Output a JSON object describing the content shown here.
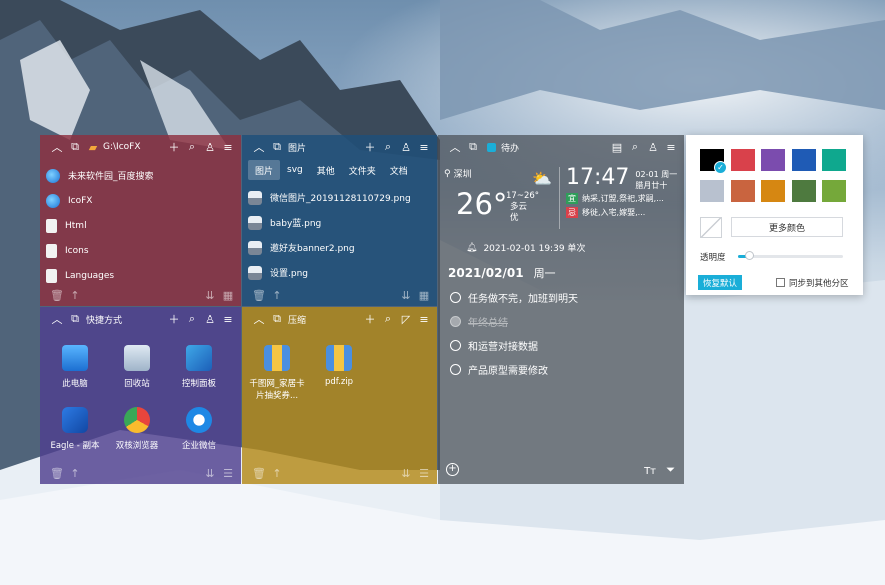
{
  "colors": {
    "folder_panel": "#8e3040",
    "images_panel": "#1e4f7a",
    "shortcuts_panel": "#4f3f8f",
    "compress_panel": "#b58a19",
    "todo_panel": "#4a4f56",
    "accent": "#1aaed8"
  },
  "folder_panel": {
    "title": "G:\\IcoFX",
    "items": [
      {
        "label": "未来软件园_百度搜索",
        "icon": "browser-icon"
      },
      {
        "label": "IcoFX",
        "icon": "browser-icon"
      },
      {
        "label": "Html",
        "icon": "file-icon"
      },
      {
        "label": "Icons",
        "icon": "file-icon"
      },
      {
        "label": "Languages",
        "icon": "file-icon"
      }
    ]
  },
  "images_panel": {
    "title": "图片",
    "tabs": [
      "图片",
      "svg",
      "其他",
      "文件夹",
      "文档"
    ],
    "items": [
      {
        "label": "微信图片_20191128110729.png",
        "icon": "image-file-icon"
      },
      {
        "label": "baby蓝.png",
        "icon": "image-file-icon"
      },
      {
        "label": "邀好友banner2.png",
        "icon": "image-file-icon"
      },
      {
        "label": "设置.png",
        "icon": "image-file-icon"
      }
    ]
  },
  "shortcuts_panel": {
    "title": "快捷方式",
    "items": [
      {
        "label": "此电脑",
        "icon": "computer-icon"
      },
      {
        "label": "回收站",
        "icon": "recycle-bin-icon"
      },
      {
        "label": "控制面板",
        "icon": "control-panel-icon"
      },
      {
        "label": "Eagle - 副本",
        "icon": "eagle-icon"
      },
      {
        "label": "双核浏览器",
        "icon": "chrome-icon"
      },
      {
        "label": "企业微信",
        "icon": "wecom-icon"
      }
    ]
  },
  "compress_panel": {
    "title": "压缩",
    "items": [
      {
        "label": "千图网_家居卡片抽奖券...",
        "icon": "zip-icon"
      },
      {
        "label": "pdf.zip",
        "icon": "zip-icon"
      }
    ]
  },
  "todo_panel": {
    "title": "待办",
    "city": "深圳",
    "temperature": "26°",
    "temp_range": "17~26°",
    "weather": "多云",
    "air": "优",
    "time": "17:47",
    "date_short": "02-01 周一",
    "lunar": "腊月廿十",
    "good_tag": "宜",
    "good_text": "纳采,订盟,祭祀,求嗣,...",
    "bad_tag": "忌",
    "bad_text": "移徙,入宅,嫁娶,...",
    "reminder": "2021-02-01 19:39  单次",
    "date_heading": "2021/02/01",
    "weekday": "周一",
    "tasks": [
      {
        "text": "任务做不完，加班到明天",
        "done": false
      },
      {
        "text": "年终总结",
        "done": true
      },
      {
        "text": "和运营对接数据",
        "done": false
      },
      {
        "text": "产品原型需要修改",
        "done": false
      }
    ]
  },
  "color_picker": {
    "swatches": [
      "#000000",
      "#d9414b",
      "#7b4cae",
      "#1f5bb5",
      "#0fa88e",
      "#b8c1cf",
      "#c9643f",
      "#d68712",
      "#4e7a3f",
      "#75a83a"
    ],
    "selected_index": 0,
    "more_colors_label": "更多颜色",
    "opacity_label": "透明度",
    "opacity_level": 0.1,
    "reset_label": "恢复默认",
    "sync_label": "同步到其他分区"
  }
}
